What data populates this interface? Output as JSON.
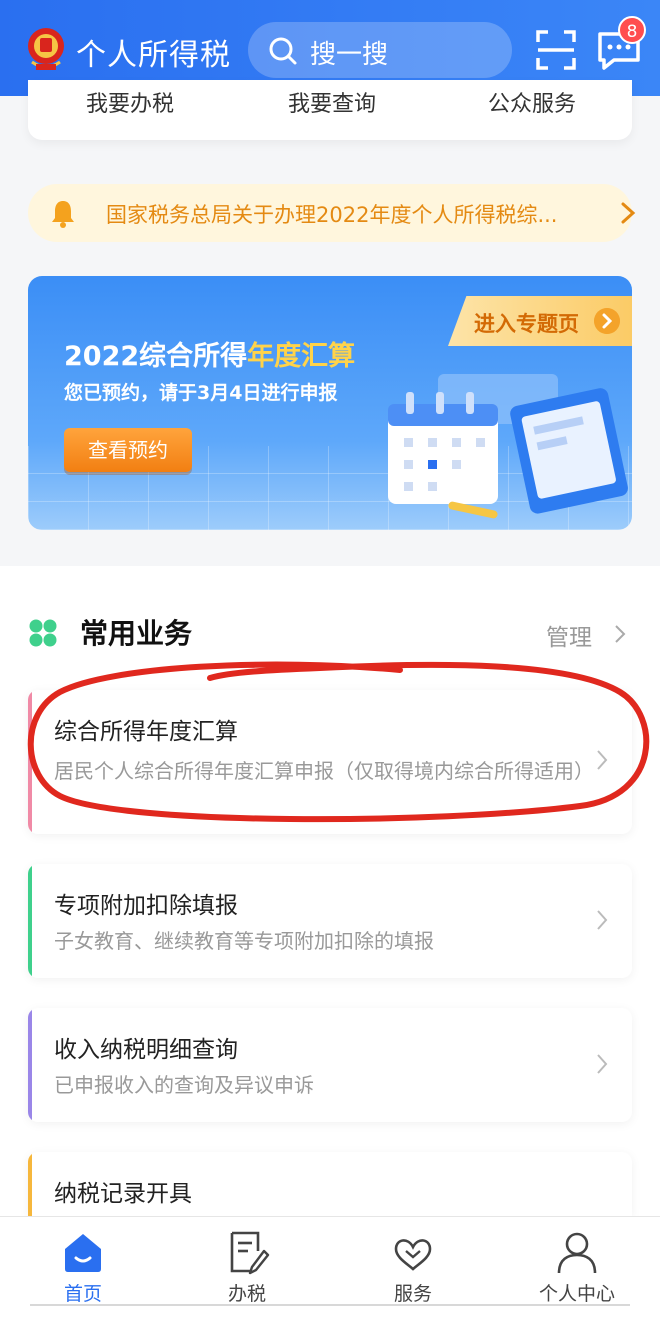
{
  "header": {
    "title": "个人所得税",
    "search_placeholder": "搜一搜",
    "message_count": "8"
  },
  "quick_menu": [
    "我要办税",
    "我要查询",
    "公众服务"
  ],
  "notice": {
    "text": "国家税务总局关于办理2022年度个人所得税综..."
  },
  "banner": {
    "title_part1": "2022综合所得",
    "title_highlight": "年度汇算",
    "subtitle": "您已预约，请于3月4日进行申报",
    "button_label": "查看预约",
    "tag_label": "进入专题页"
  },
  "services": {
    "title": "常用业务",
    "manage_label": "管理",
    "items": [
      {
        "title": "综合所得年度汇算",
        "desc": "居民个人综合所得年度汇算申报（仅取得境内综合所得适用）",
        "accent": "#f08aa6"
      },
      {
        "title": "专项附加扣除填报",
        "desc": "子女教育、继续教育等专项附加扣除的填报",
        "accent": "#3fd08c"
      },
      {
        "title": "收入纳税明细查询",
        "desc": "已申报收入的查询及异议申诉",
        "accent": "#9a86e8"
      },
      {
        "title": "纳税记录开具",
        "desc": "",
        "accent": "#f6b73c"
      }
    ]
  },
  "bottom_nav": [
    {
      "label": "首页",
      "icon": "home-icon",
      "active": true
    },
    {
      "label": "办税",
      "icon": "tax-form-icon",
      "active": false
    },
    {
      "label": "服务",
      "icon": "service-heart-icon",
      "active": false
    },
    {
      "label": "个人中心",
      "icon": "person-icon",
      "active": false
    }
  ],
  "colors": {
    "brand_blue": "#2a6ff0",
    "annotation_red": "#e0281e",
    "notice_orange": "#e48a13"
  }
}
